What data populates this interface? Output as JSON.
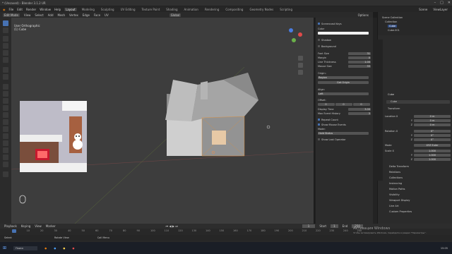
{
  "title": "* (Unsaved) - Blender 3.1.2 UR",
  "menu": [
    "File",
    "Edit",
    "Render",
    "Window",
    "Help"
  ],
  "workspaces": [
    "Layout",
    "Modeling",
    "Sculpting",
    "UV Editing",
    "Texture Paint",
    "Shading",
    "Animation",
    "Rendering",
    "Compositing",
    "Geometry Nodes",
    "Scripting"
  ],
  "scene": "Scene",
  "view_layer": "ViewLayer",
  "viewport_header": {
    "mode": "Edit Mode",
    "menus": [
      "View",
      "Select",
      "Add",
      "Mesh",
      "Vertex",
      "Edge",
      "Face",
      "UV"
    ],
    "orientation": "Global",
    "options": "Options"
  },
  "viewport_info": {
    "line1": "User Orthographic",
    "line2": "(1) Cube"
  },
  "npanel": {
    "title": "Screencast Keys",
    "color_label": "Color",
    "shadow": "Shadow",
    "background": "Background",
    "font_size_label": "Font Size",
    "font_size": "31",
    "margin_label": "Margin",
    "margin": "0",
    "line_thickness_label": "Line Thickness",
    "line_thickness": "1.00",
    "mouse_size_label": "Mouse Size",
    "mouse_size": "33",
    "origin_label": "Origin:",
    "origin": "Region",
    "get_origin": "Get Origin",
    "align_label": "Align:",
    "align": "Left",
    "offset_label": "Offset:",
    "offset_x": "0",
    "offset_y": "0",
    "offset_z": "0",
    "display_time_label": "Display Time",
    "display_time": "3.00",
    "max_history_label": "Max Event History",
    "max_history": "3",
    "repeat_count": "Repeat Count",
    "show_mouse_events": "Show Mouse Events",
    "mode_label": "Mode:",
    "mode": "Hold Status",
    "show_last_operator": "Show Last Operator"
  },
  "outliner": {
    "root": "Scene Collection",
    "items": [
      "Collection",
      "Cube",
      "Cube.001"
    ]
  },
  "properties": {
    "object_name": "Cube",
    "mesh_name": "Cube",
    "transform": "Transform",
    "location_label": "Location X",
    "loc": [
      "0 m",
      "0 m",
      "0 m"
    ],
    "rotation_label": "Rotation X",
    "rot": [
      "0°",
      "0°",
      "0°"
    ],
    "mode_label": "Mode",
    "rot_mode": "XYZ Euler",
    "scale_label": "Scale X",
    "scale": [
      "1.000",
      "1.000",
      "1.000"
    ],
    "axis_y": "Y",
    "axis_z": "Z",
    "sections": [
      "Delta Transform",
      "Relations",
      "Collections",
      "Instancing",
      "Motion Paths",
      "Visibility",
      "Viewport Display",
      "Line Art",
      "Custom Properties"
    ]
  },
  "timeline": {
    "menus": [
      "Playback",
      "Keying",
      "View",
      "Marker"
    ],
    "current": "1",
    "start": "Start",
    "start_val": "1",
    "end": "End",
    "end_val": "250",
    "ticks": [
      "1",
      "10",
      "20",
      "30",
      "40",
      "50",
      "60",
      "70",
      "80",
      "90",
      "100",
      "110",
      "120",
      "130",
      "140",
      "150",
      "160",
      "170",
      "180",
      "190",
      "200",
      "210",
      "220",
      "230",
      "240",
      "250"
    ]
  },
  "status": [
    "Select",
    "Rotate View",
    "Call Menu"
  ],
  "watermark": [
    "Активация Windows",
    "Чтобы активировать Windows, перейдите в раздел \"Параметры\"."
  ],
  "taskbar": {
    "search": "Поиск",
    "time": "15:05"
  },
  "colors": {
    "accent": "#4772b3",
    "viewport_bg": "#3d3d3d",
    "house_light": "#cfcfcf",
    "house_dark": "#8e8e8e"
  }
}
